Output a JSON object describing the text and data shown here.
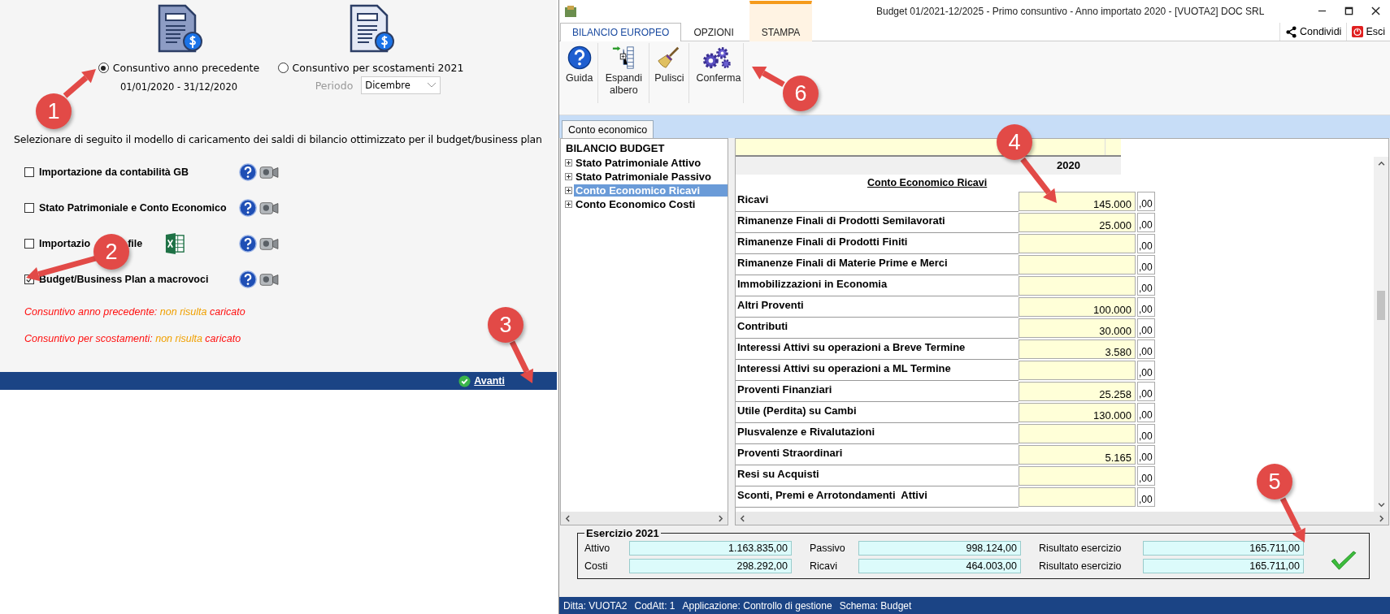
{
  "left_panel": {
    "options": [
      {
        "label": "Consuntivo anno precedente",
        "selected": true,
        "detail": "01/01/2020 - 31/12/2020"
      },
      {
        "label": "Consuntivo per scostamenti 2021",
        "selected": false,
        "period_label": "Periodo",
        "period_value": "Dicembre"
      }
    ],
    "instruction": "Selezionare di seguito il modello di caricamento dei saldi di bilancio ottimizzato per il budget/business plan",
    "models": [
      {
        "label": "Importazione da contabilità GB",
        "checked": false
      },
      {
        "label": "Stato Patrimoniale e Conto Economico",
        "checked": false
      },
      {
        "label": "Importazio",
        "label_after": "file",
        "checked": false,
        "excel": true
      },
      {
        "label": "Budget/Business Plan a macrovoci",
        "checked": true
      }
    ],
    "warnings": [
      {
        "before": "Consuntivo anno precedente: ",
        "highlight": "non risulta",
        "after": " caricato"
      },
      {
        "before": "Consuntivo per scostamenti: ",
        "highlight": "non risulta",
        "after": " caricato"
      }
    ],
    "next_button": "Avanti"
  },
  "window": {
    "title": "Budget 01/2021-12/2025 - Primo consuntivo - Anno importato 2020 - [VUOTA2] DOC SRL"
  },
  "ribbon": {
    "tabs": [
      {
        "label": "BILANCIO EUROPEO",
        "selected": true,
        "contextual": false
      },
      {
        "label": "OPZIONI",
        "selected": false,
        "contextual": false
      },
      {
        "label": "STAMPA",
        "selected": false,
        "contextual": true
      }
    ],
    "actions": [
      {
        "label": "Condividi",
        "kind": "share"
      },
      {
        "label": "Esci",
        "kind": "exit"
      }
    ],
    "buttons": [
      {
        "label": "Guida",
        "kind": "help"
      },
      {
        "label": "Espandi albero",
        "kind": "expand"
      },
      {
        "label": "Pulisci",
        "kind": "broom"
      },
      {
        "label": "Conferma",
        "kind": "gears"
      }
    ]
  },
  "sheet_tabs": [
    {
      "label": "Conto economico",
      "selected": true
    }
  ],
  "tree": {
    "title": "BILANCIO BUDGET",
    "items": [
      {
        "label": "Stato Patrimoniale Attivo",
        "selected": false
      },
      {
        "label": "Stato Patrimoniale Passivo",
        "selected": false
      },
      {
        "label": "Conto Economico Ricavi",
        "selected": true
      },
      {
        "label": "Conto Economico Costi",
        "selected": false
      }
    ]
  },
  "grid": {
    "year": "2020",
    "section": "Conto Economico Ricavi",
    "rows": [
      {
        "label": "Ricavi",
        "value": "145.000",
        "decimals": ",00"
      },
      {
        "label": "Rimanenze Finali di Prodotti Semilavorati",
        "value": "25.000",
        "decimals": ",00"
      },
      {
        "label": "Rimanenze Finali di Prodotti Finiti",
        "decimals": ",00"
      },
      {
        "label": "Rimanenze Finali di Materie Prime e Merci",
        "decimals": ",00"
      },
      {
        "label": "Immobilizzazioni in Economia",
        "decimals": ",00"
      },
      {
        "label": "Altri Proventi",
        "value": "100.000",
        "decimals": ",00"
      },
      {
        "label": "Contributi",
        "value": "30.000",
        "decimals": ",00"
      },
      {
        "label": "Interessi Attivi su operazioni a Breve Termine",
        "value": "3.580",
        "decimals": ",00"
      },
      {
        "label": "Interessi Attivi su operazioni a ML Termine",
        "decimals": ",00"
      },
      {
        "label": "Proventi Finanziari",
        "value": "25.258",
        "decimals": ",00"
      },
      {
        "label": "Utile (Perdita) su Cambi",
        "value": "130.000",
        "decimals": ",00"
      },
      {
        "label": "Plusvalenze e Rivalutazioni",
        "decimals": ",00"
      },
      {
        "label": "Proventi Straordinari",
        "value": "5.165",
        "decimals": ",00"
      },
      {
        "label": "Resi su Acquisti",
        "decimals": ",00"
      },
      {
        "label": "Sconti, Premi e Arrotondamenti  Attivi",
        "decimals": ",00"
      }
    ]
  },
  "summary": {
    "title": "Esercizio 2021",
    "fields": [
      {
        "label": "Attivo",
        "value": "1.163.835,00"
      },
      {
        "label": "Passivo",
        "value": "998.124,00"
      },
      {
        "label": "Risultato esercizio",
        "value": "165.711,00"
      },
      {
        "label": "Costi",
        "value": "298.292,00"
      },
      {
        "label": "Ricavi",
        "value": "464.003,00"
      },
      {
        "label": "Risultato esercizio",
        "value": "165.711,00"
      }
    ]
  },
  "status_bar": [
    "Ditta: VUOTA2",
    "CodAtt: 1",
    "Applicazione: Controllo di gestione",
    "Schema: Budget"
  ],
  "callouts": [
    "1",
    "2",
    "3",
    "4",
    "5",
    "6"
  ]
}
